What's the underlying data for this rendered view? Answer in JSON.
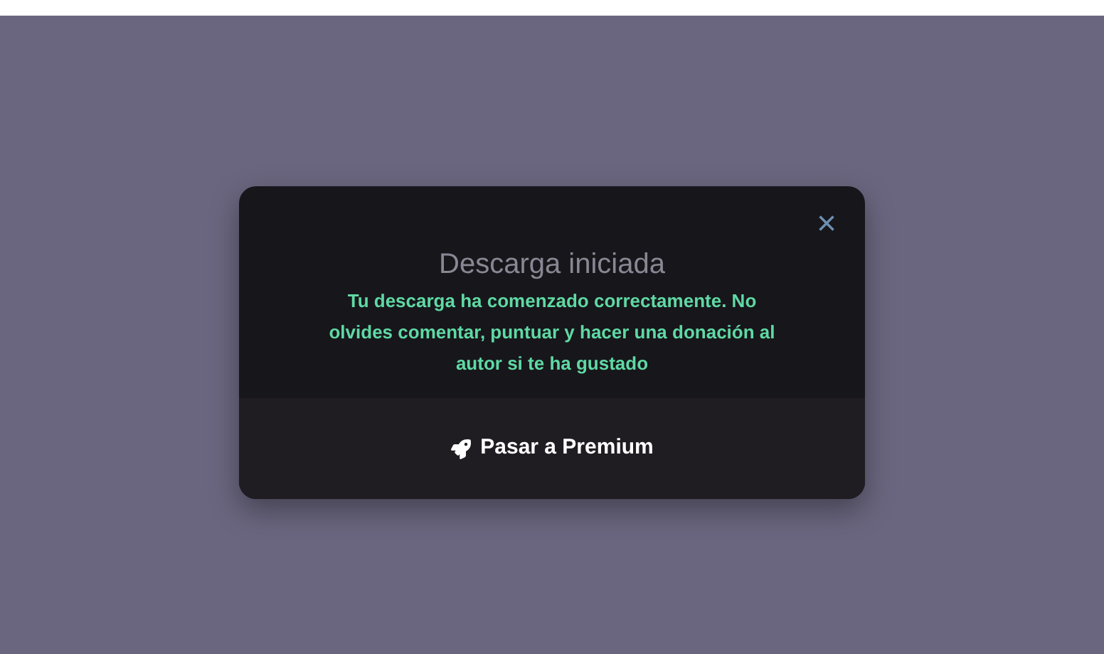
{
  "dialog": {
    "title": "Descarga iniciada",
    "message": "Tu descarga ha comenzado correctamente. No olvides comentar, puntuar y hacer una donación al autor si te ha gustado",
    "close": "×",
    "action": "Pasar a Premium"
  }
}
